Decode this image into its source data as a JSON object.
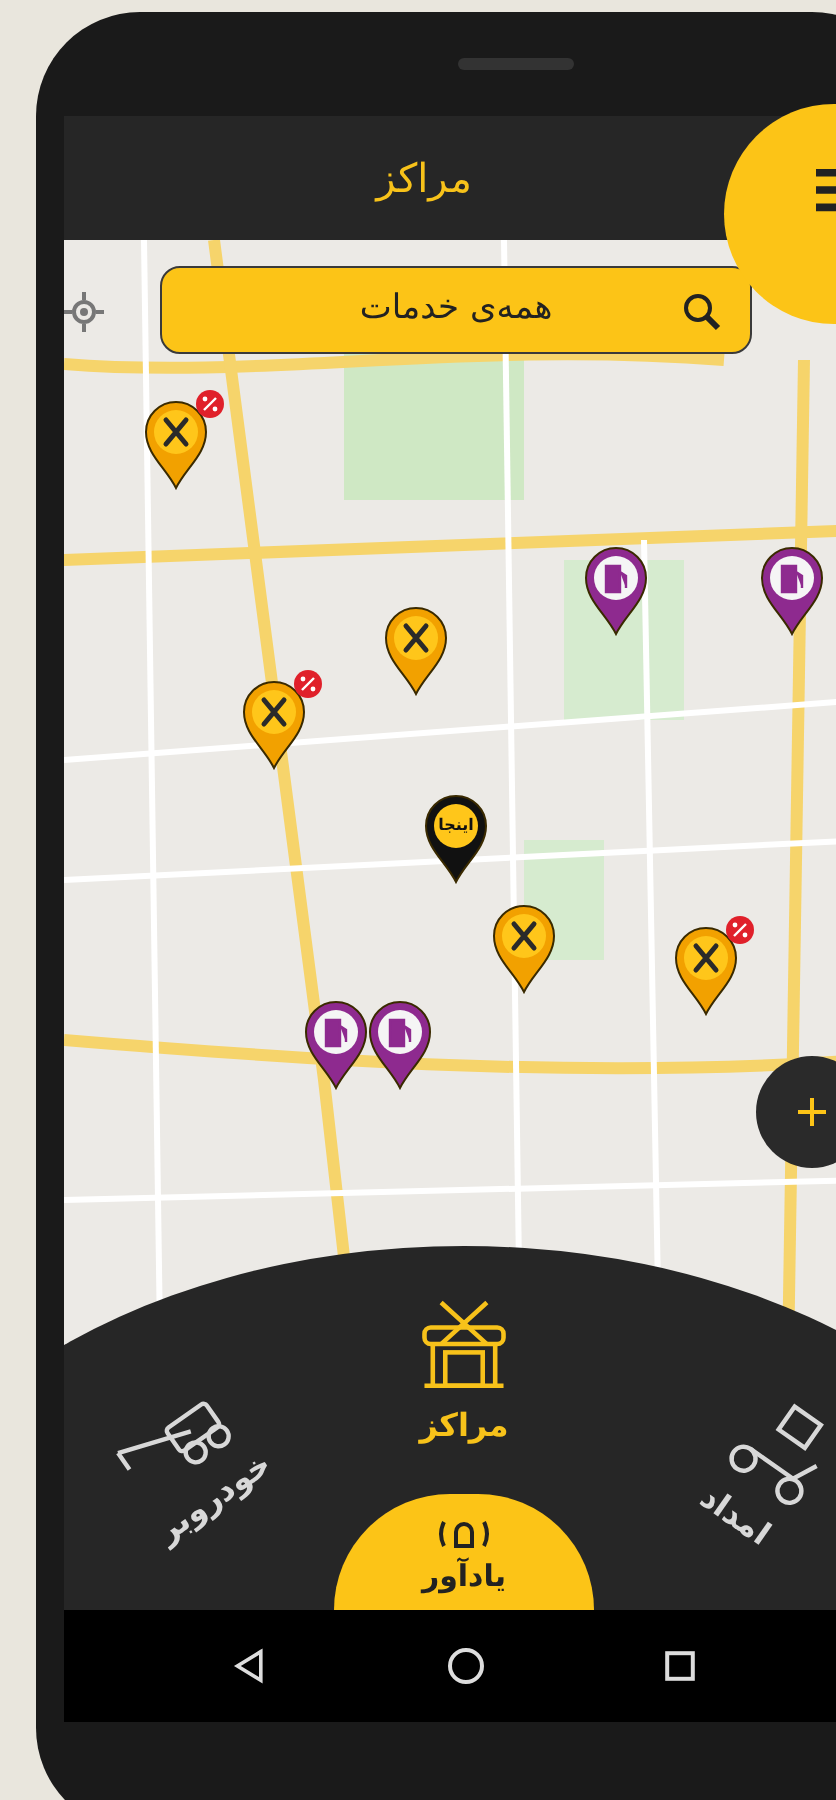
{
  "header": {
    "title": "مراکز"
  },
  "search": {
    "label": "همه‌ی خدمات"
  },
  "pins": [
    {
      "kind": "service",
      "discount": true
    },
    {
      "kind": "service",
      "discount": false
    },
    {
      "kind": "service",
      "discount": true
    },
    {
      "kind": "fuel",
      "discount": false
    },
    {
      "kind": "fuel",
      "discount": false
    },
    {
      "kind": "here",
      "discount": false,
      "label": "اینجا"
    },
    {
      "kind": "service",
      "discount": false
    },
    {
      "kind": "service",
      "discount": true
    },
    {
      "kind": "fuel",
      "discount": false
    },
    {
      "kind": "fuel",
      "discount": false
    }
  ],
  "menu": [
    {
      "kind": "tow",
      "label": "خودروبر",
      "selected": false
    },
    {
      "kind": "centers",
      "label": "مراکز",
      "selected": true
    },
    {
      "kind": "rescue",
      "label": "امداد",
      "selected": false
    }
  ],
  "reminder": {
    "label": "یادآور"
  }
}
